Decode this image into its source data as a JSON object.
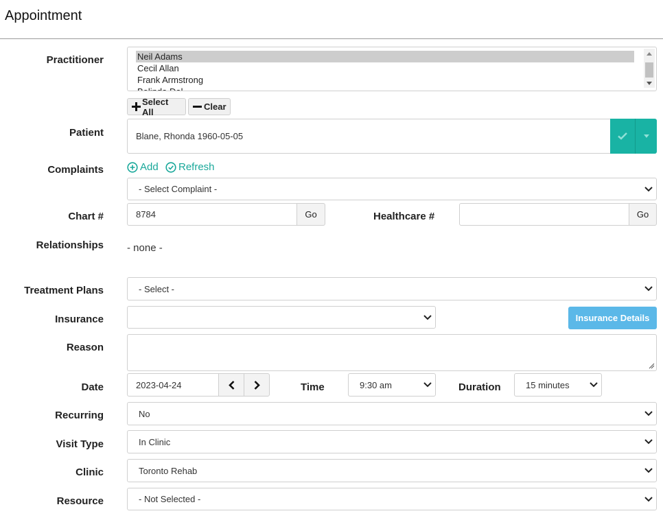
{
  "title": "Appointment",
  "practitioner": {
    "label": "Practitioner",
    "options": [
      "Neil Adams",
      "Cecil Allan",
      "Frank Armstrong",
      "Belinda Dal..."
    ],
    "select_all": "Select All",
    "clear": "Clear"
  },
  "patient": {
    "label": "Patient",
    "value": "Blane, Rhonda 1960-05-05",
    "accent": "#19b3a4"
  },
  "complaints": {
    "label": "Complaints",
    "add": "Add",
    "refresh": "Refresh",
    "select_value": "- Select Complaint -"
  },
  "chart": {
    "label": "Chart #",
    "value": "8784",
    "go": "Go"
  },
  "healthcare": {
    "label": "Healthcare #",
    "value": "",
    "go": "Go"
  },
  "relationships": {
    "label": "Relationships",
    "value": "- none -"
  },
  "treatment_plans": {
    "label": "Treatment Plans",
    "value": "- Select -"
  },
  "insurance": {
    "label": "Insurance",
    "value": "",
    "details_button": "Insurance Details",
    "details_color": "#5bb8e8"
  },
  "reason": {
    "label": "Reason",
    "value": ""
  },
  "date": {
    "label": "Date",
    "value": "2023-04-24"
  },
  "time": {
    "label": "Time",
    "value": "9:30 am"
  },
  "duration": {
    "label": "Duration",
    "value": "15 minutes"
  },
  "recurring": {
    "label": "Recurring",
    "value": "No"
  },
  "visit_type": {
    "label": "Visit Type",
    "value": "In Clinic"
  },
  "clinic": {
    "label": "Clinic",
    "value": "Toronto Rehab"
  },
  "resource": {
    "label": "Resource",
    "value": "- Not Selected -"
  }
}
